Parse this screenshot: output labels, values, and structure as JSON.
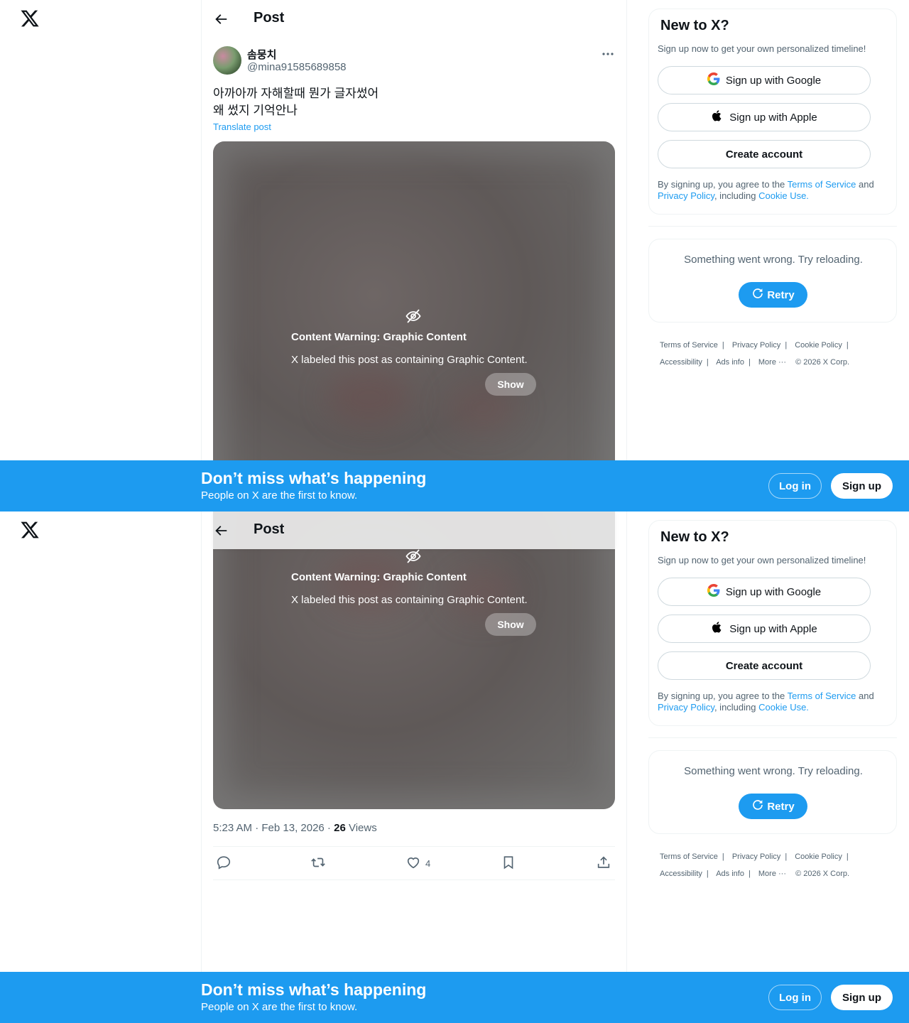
{
  "header": {
    "title": "Post"
  },
  "post": {
    "author_name": "솜뭉치",
    "author_handle": "@mina91585689858",
    "text_line1": "아까아까 자해할때 뭔가 글자썼어",
    "text_line2": "왜 썼지 기억안나",
    "translate_label": "Translate post",
    "content_warning_title": "Content Warning: Graphic Content",
    "content_warning_desc": "X labeled this post as containing Graphic Content.",
    "show_label": "Show",
    "timestamp": "5:23 AM · Feb 13, 2026 · ",
    "views_count": "26",
    "views_label": "Views",
    "like_count": "4"
  },
  "signup_card": {
    "heading": "New to X?",
    "subtitle": "Sign up now to get your own personalized timeline!",
    "google_label": "Sign up with Google",
    "apple_label": "Sign up with Apple",
    "create_label": "Create account",
    "legal_prefix": "By signing up, you agree to the ",
    "terms_link": "Terms of Service",
    "legal_and": " and",
    "privacy_link": "Privacy Policy",
    "legal_including": ", including ",
    "cookie_link": "Cookie Use."
  },
  "error_card": {
    "message": "Something went wrong. Try reloading.",
    "retry_label": "Retry"
  },
  "footer": {
    "terms": "Terms of Service",
    "privacy": "Privacy Policy",
    "cookie": "Cookie Policy",
    "accessibility": "Accessibility",
    "ads": "Ads info",
    "more": "More ···",
    "copyright": "© 2026 X Corp."
  },
  "banner": {
    "title": "Don’t miss what’s happening",
    "subtitle": "People on X are the first to know.",
    "login_label": "Log in",
    "signup_label": "Sign up"
  },
  "colors": {
    "accent": "#1d9bf0",
    "text_primary": "#0f1419",
    "text_secondary": "#536471",
    "border": "#eff3f4"
  },
  "icons": [
    "x-logo-icon",
    "back-arrow-icon",
    "more-icon",
    "eye-slash-icon",
    "reply-icon",
    "repost-icon",
    "like-icon",
    "bookmark-icon",
    "share-icon",
    "google-icon",
    "apple-icon",
    "refresh-icon"
  ]
}
